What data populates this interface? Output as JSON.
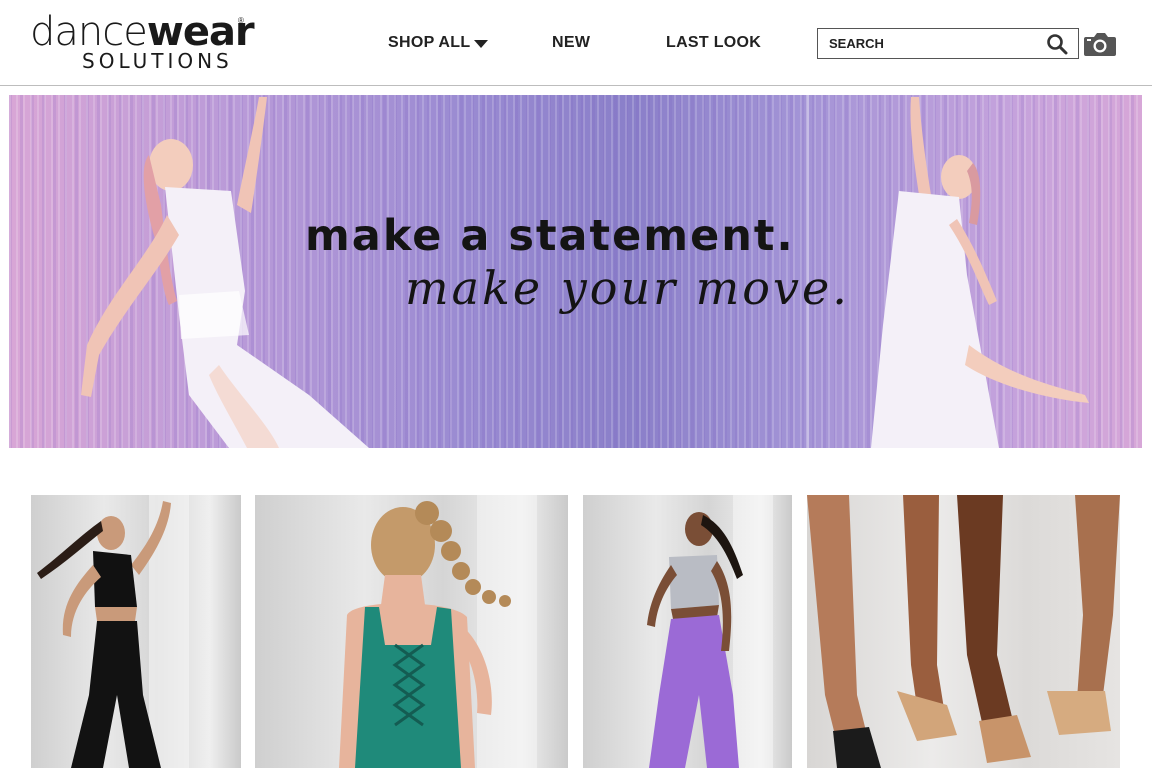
{
  "brand": {
    "logo_part1": "dance",
    "logo_part2": "wear",
    "logo_sub": "SOLUTIONS",
    "logo_mark": "®"
  },
  "nav": {
    "items": [
      {
        "label": "SHOP ALL",
        "has_dropdown": true
      },
      {
        "label": "NEW"
      },
      {
        "label": "LAST LOOK"
      }
    ]
  },
  "search": {
    "placeholder": "SEARCH",
    "value": "",
    "icon": "search-icon",
    "camera_icon": "camera-icon"
  },
  "hero": {
    "line1": "make a statement.",
    "line2": "make your move."
  },
  "tiles": [
    {
      "image": "dancer in black mock-neck top and black flare pants"
    },
    {
      "image": "dancer in teal lace-up back leotard"
    },
    {
      "image": "dancer in grey crop top and purple pants"
    },
    {
      "image": "dancers' feet in tan and black jazz shoes"
    }
  ],
  "colors": {
    "text": "#1a1a1a",
    "hero_lilac": "#9a8bd2",
    "hero_pink": "#d9a6d6",
    "teal": "#1f8a7a",
    "purple": "#9b6ad6"
  }
}
